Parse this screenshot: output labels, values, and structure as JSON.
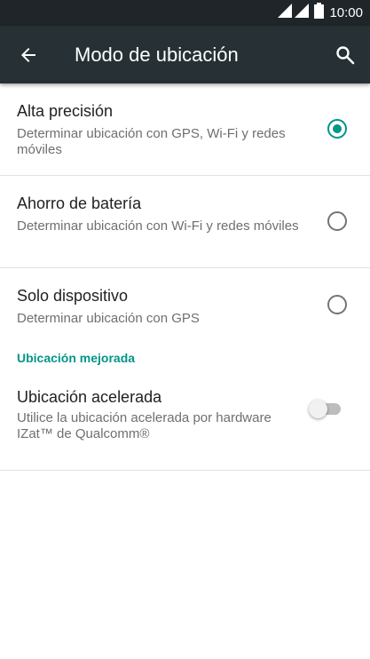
{
  "status_bar": {
    "time": "10:00",
    "icons": [
      "signal-icon",
      "signal-icon",
      "battery-icon"
    ]
  },
  "toolbar": {
    "title": "Modo de ubicación",
    "back_icon": "arrow-back-icon",
    "search_icon": "search-icon"
  },
  "modes": [
    {
      "title": "Alta precisión",
      "summary": "Determinar ubicación con GPS, Wi-Fi y redes móviles",
      "selected": true
    },
    {
      "title": "Ahorro de batería",
      "summary": "Determinar ubicación con Wi-Fi y redes móviles",
      "selected": false
    },
    {
      "title": "Solo dispositivo",
      "summary": "Determinar ubicación con GPS",
      "selected": false
    }
  ],
  "improved": {
    "header": "Ubicación mejorada",
    "accelerated": {
      "title": "Ubicación acelerada",
      "summary": "Utilice la ubicación acelerada por hardware IZat™ de Qualcomm®",
      "enabled": false
    }
  },
  "colors": {
    "accent": "#009688",
    "appbar": "#263035",
    "statusbar": "#1f2528"
  }
}
